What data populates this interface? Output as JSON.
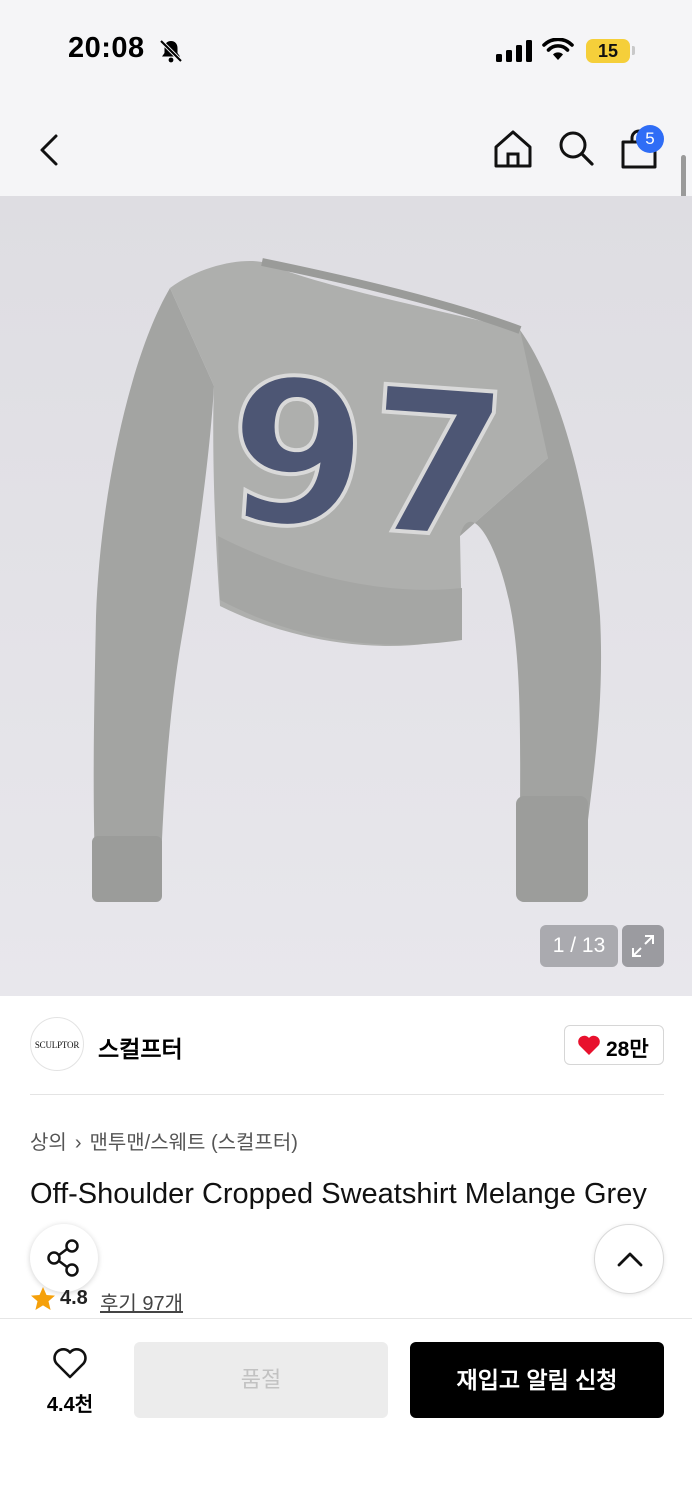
{
  "status_bar": {
    "time": "20:08",
    "battery": "15",
    "icons": [
      "bell-off-icon",
      "signal-icon",
      "wifi-icon",
      "battery-icon"
    ]
  },
  "nav": {
    "icons": [
      "back-icon",
      "home-icon",
      "search-icon",
      "shopping-bag-icon"
    ],
    "cart_count": "5"
  },
  "product_image": {
    "graphic_text": "97",
    "counter": "1 / 13"
  },
  "brand": {
    "logo_text": "SCULPTOR",
    "name": "스컬프터",
    "likes": "28만"
  },
  "breadcrumb": {
    "category": "상의",
    "subcategory": "맨투맨/스웨트 (스컬프터)"
  },
  "product": {
    "title": "Off-Shoulder Cropped Sweatshirt Melange Grey",
    "rating": "4.8",
    "reviews_label": "후기 97개"
  },
  "bottom_bar": {
    "wish_count": "4.4천",
    "soldout_label": "품절",
    "restock_label": "재입고 알림 신청"
  },
  "colors": {
    "accent_blue": "#2f6df6",
    "heart_red": "#e8112d",
    "star_orange": "#f5a00a",
    "battery_yellow": "#f5cf3a",
    "print_navy": "#4d5674",
    "garment_grey": "#a7a8a6"
  }
}
